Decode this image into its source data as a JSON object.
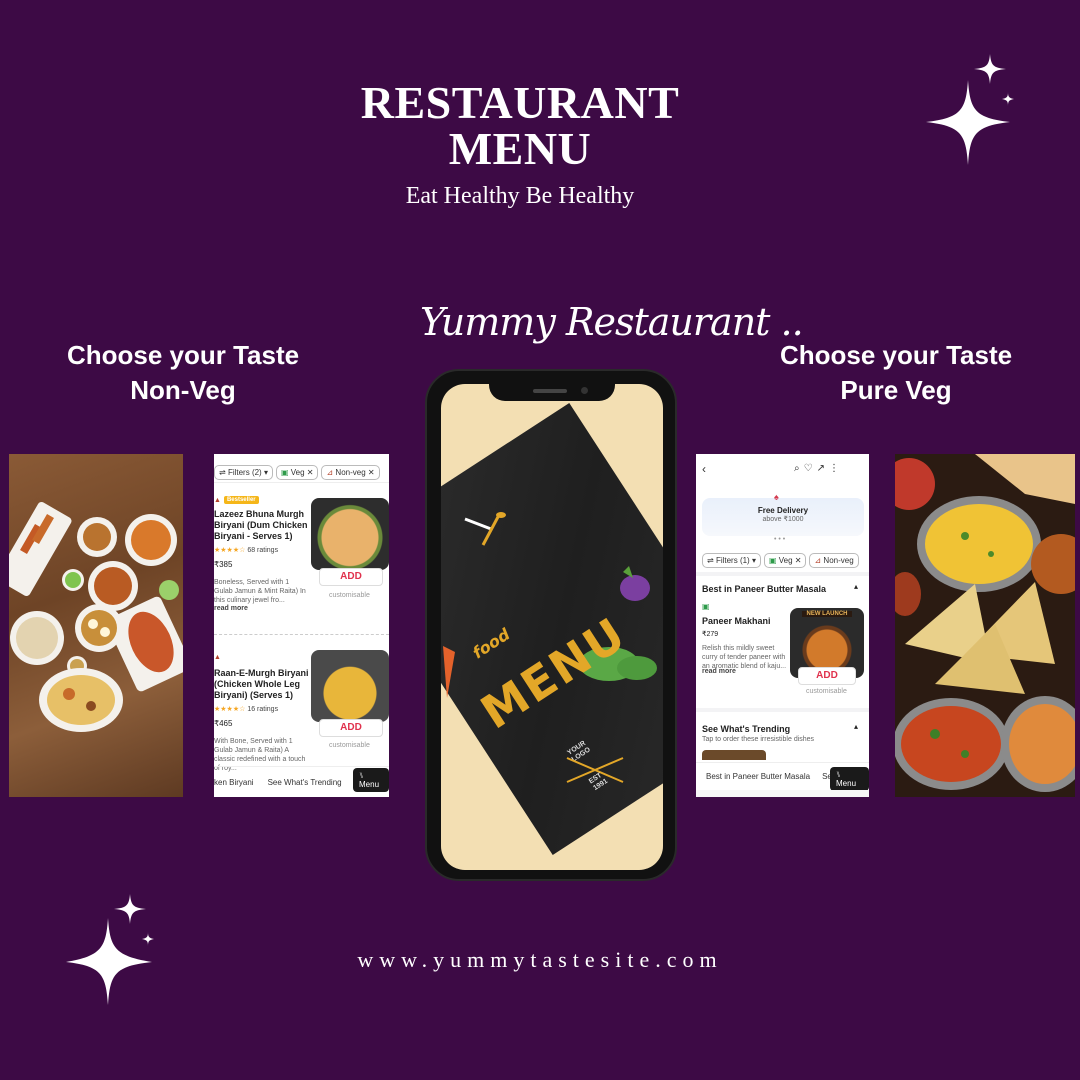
{
  "header": {
    "title_line1": "RESTAURANT",
    "title_line2": "MENU",
    "subtitle": "Eat Healthy Be Healthy"
  },
  "script_title": "Yummy Restaurant ..",
  "left_heading": {
    "line1": "Choose your Taste",
    "line2": "Non-Veg"
  },
  "right_heading": {
    "line1": "Choose your Taste",
    "line2": "Pure Veg"
  },
  "phone_screen": {
    "word_small": "food",
    "word_big": "MENU",
    "logo_line1": "YOUR",
    "logo_line2": "LOGO",
    "est_line1": "EST",
    "est_line2": "1991"
  },
  "nonveg_panel": {
    "filters": [
      {
        "label": "Filters (2)",
        "icon": "filter-icon"
      },
      {
        "label": "Veg",
        "icon": "veg-dot-icon"
      },
      {
        "label": "Non-veg",
        "icon": "nonveg-triangle-icon"
      }
    ],
    "items": [
      {
        "badge": "Bestseller",
        "name": "Lazeez Bhuna Murgh Biryani (Dum Chicken Biryani - Serves 1)",
        "ratings": "68 ratings",
        "price": "₹385",
        "desc": "Boneless, Served with 1 Gulab Jamun & Mint Raita) In this culinary jewel fro...",
        "read_more": "read more",
        "add": "ADD",
        "custom": "customisable"
      },
      {
        "badge": "",
        "name": "Raan-E-Murgh Biryani (Chicken Whole Leg Biryani) (Serves 1)",
        "ratings": "16 ratings",
        "price": "₹465",
        "desc": "With Bone, Served with 1 Gulab Jamun & Raita) A classic redefined with a touch of roy...",
        "read_more": "read more",
        "add": "ADD",
        "custom": "customisable"
      }
    ],
    "bottom_tabs": [
      "ken Biryani",
      "See What's Trending"
    ],
    "menu_button": "Menu"
  },
  "veg_panel": {
    "free_delivery": "Free Delivery",
    "free_delivery_sub": "above ₹1000",
    "filters": [
      {
        "label": "Filters (1)",
        "icon": "filter-icon"
      },
      {
        "label": "Veg",
        "icon": "veg-dot-icon"
      },
      {
        "label": "Non-veg",
        "icon": "nonveg-triangle-icon"
      }
    ],
    "section_title": "Best in Paneer Butter Masala",
    "item": {
      "name": "Paneer Makhani",
      "price": "₹279",
      "desc": "Relish this mildly sweet curry of tender paneer with an aromatic blend of kaju...",
      "read_more": "read more",
      "ribbon": "NEW LAUNCH",
      "add": "ADD",
      "custom": "customisable"
    },
    "trending_title": "See What's Trending",
    "trending_sub": "Tap to order these irresistible dishes",
    "bottom_tabs": [
      "Best in Paneer Butter Masala",
      "See"
    ],
    "menu_button": "Menu"
  },
  "footer_url": "www.yummytastesite.com",
  "colors": {
    "background": "#3d0a45",
    "accent_red": "#e0324d",
    "menu_gold": "#e3a728",
    "veg_green": "#2e9b4a"
  }
}
